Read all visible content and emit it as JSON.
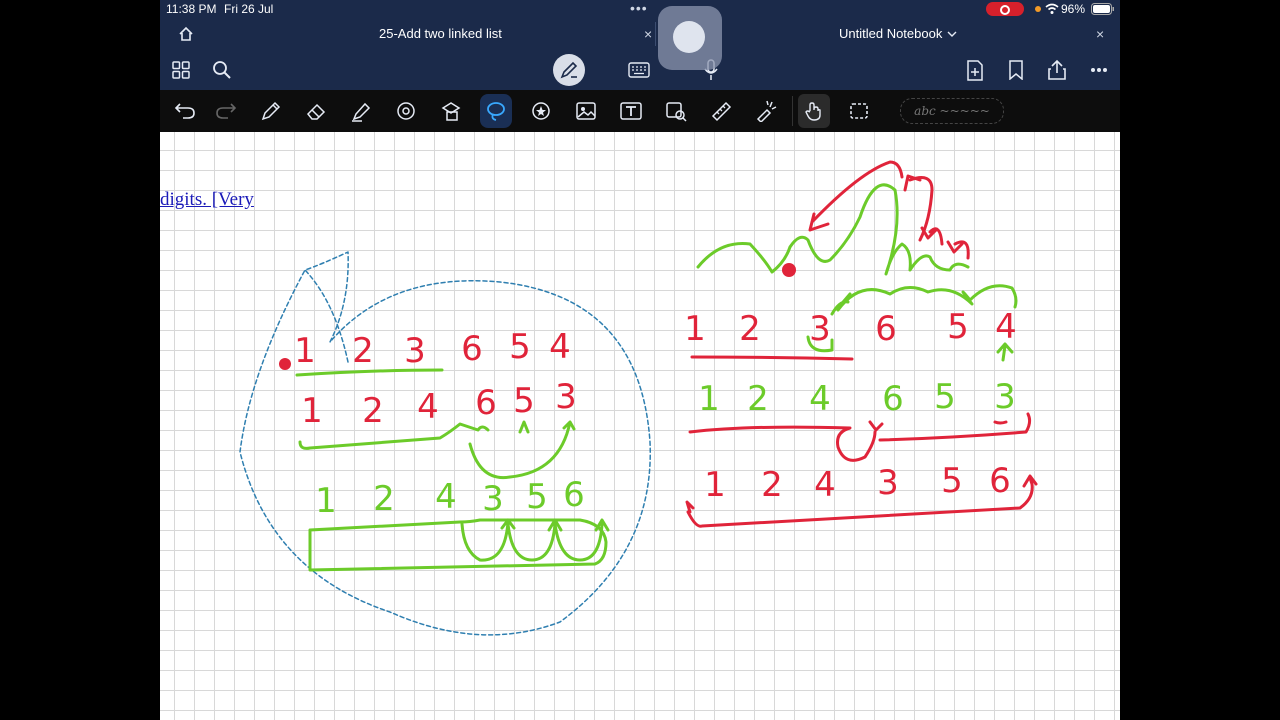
{
  "status": {
    "time": "11:38 PM",
    "date": "Fri 26 Jul",
    "battery": "96%"
  },
  "tabs": [
    {
      "label": "25-Add two linked list",
      "close": "×"
    },
    {
      "label": "Untitled Notebook",
      "close": "×"
    }
  ],
  "toolbar": {
    "textbox_placeholder": "abc ~~~~~"
  },
  "colors": {
    "header": "#1b2a4a",
    "toolbar": "#0d0d0d",
    "ink_red": "#e0243a",
    "ink_green": "#6ccb2a",
    "ink_blue_dashed": "#2f7fb0"
  },
  "canvas": {
    "doc_snippet": "digits. [Very",
    "left": {
      "row1": [
        "1",
        "2",
        "3",
        "6",
        "5",
        "4"
      ],
      "row2": [
        "1",
        "2",
        "4",
        "6",
        "5",
        "3"
      ],
      "row3": [
        "1",
        "2",
        "4",
        "3",
        "5",
        "6"
      ]
    },
    "right": {
      "row1": [
        "1",
        "2",
        "3",
        "6",
        "5",
        "4"
      ],
      "row2": [
        "1",
        "2",
        "4",
        "6",
        "5",
        "3"
      ],
      "row3": [
        "1",
        "2",
        "4",
        "3",
        "5",
        "6"
      ]
    }
  }
}
